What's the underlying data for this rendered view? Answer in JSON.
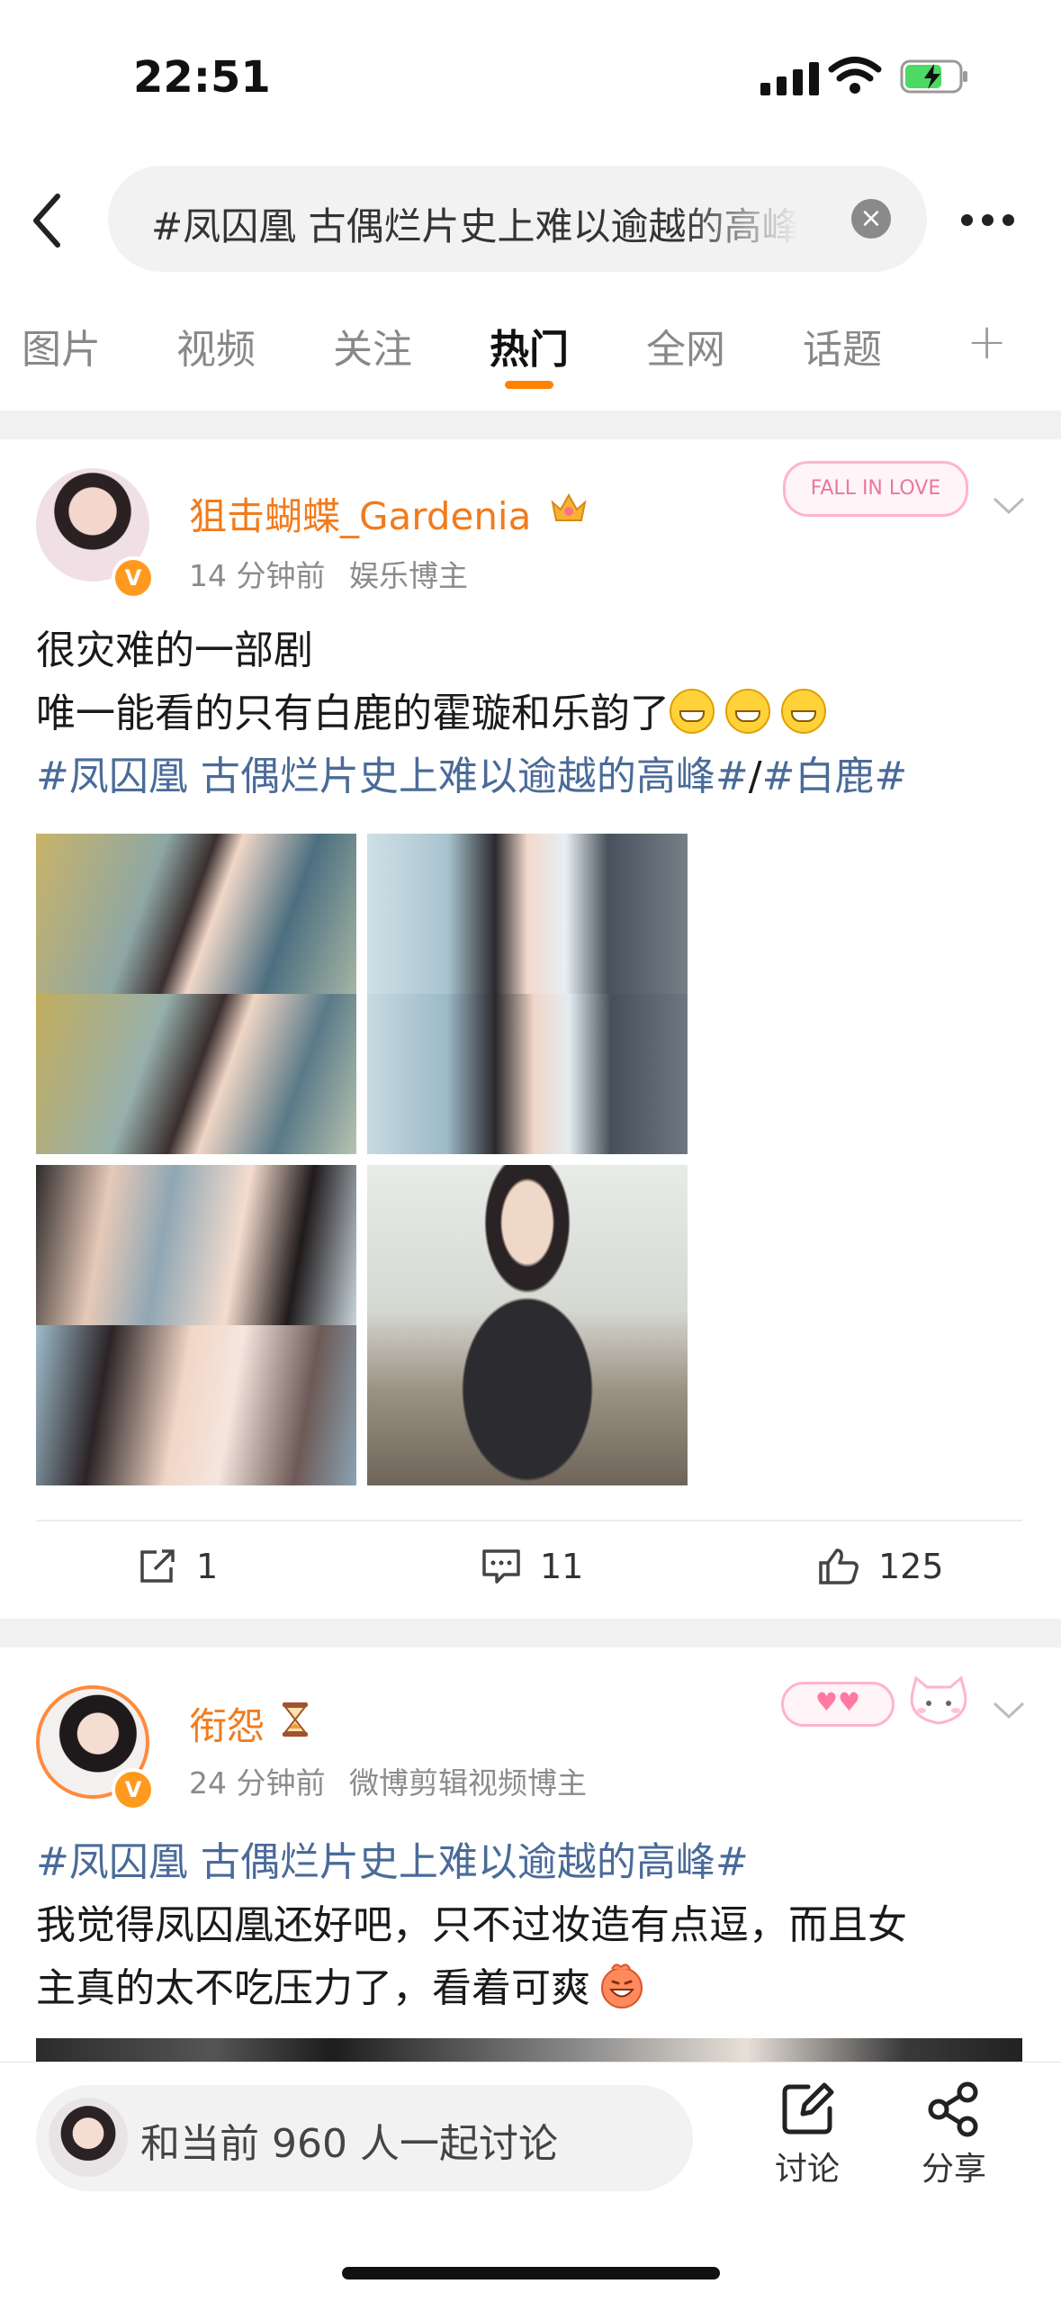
{
  "status_bar": {
    "time": "22:51"
  },
  "search": {
    "query": "#凤囚凰 古偶烂片史上难以逾越的高峰#"
  },
  "tabs": [
    {
      "label": "图片"
    },
    {
      "label": "视频"
    },
    {
      "label": "关注"
    },
    {
      "label": "热门",
      "active": true
    },
    {
      "label": "全网"
    },
    {
      "label": "话题"
    }
  ],
  "posts": [
    {
      "username": "狙击蝴蝶_Gardenia",
      "time": "14 分钟前",
      "tag": "娱乐博主",
      "badge_text": "FALL IN LOVE",
      "text_line1": "很灾难的一部剧",
      "text_line2": "唯一能看的只有白鹿的霍璇和乐韵了",
      "hashtag1": "#凤囚凰 古偶烂片史上难以逾越的高峰#",
      "slash": "/",
      "hashtag2": "#白鹿#",
      "reposts": "1",
      "comments": "11",
      "likes": "125"
    },
    {
      "username": "衔怨",
      "time": "24 分钟前",
      "tag": "微博剪辑视频博主",
      "hashtag": "#凤囚凰 古偶烂片史上难以逾越的高峰#",
      "text_line1": "我觉得凤囚凰还好吧，只不过妆造有点逗，而且女",
      "text_line2": "主真的太不吃压力了，看着可爽"
    }
  ],
  "bottom_bar": {
    "discuss_placeholder": "和当前 960 人一起讨论",
    "discuss_label": "讨论",
    "share_label": "分享"
  },
  "colors": {
    "accent_orange": "#ff8200",
    "username": "#f27b1c",
    "hashtag": "#4a6b99"
  }
}
